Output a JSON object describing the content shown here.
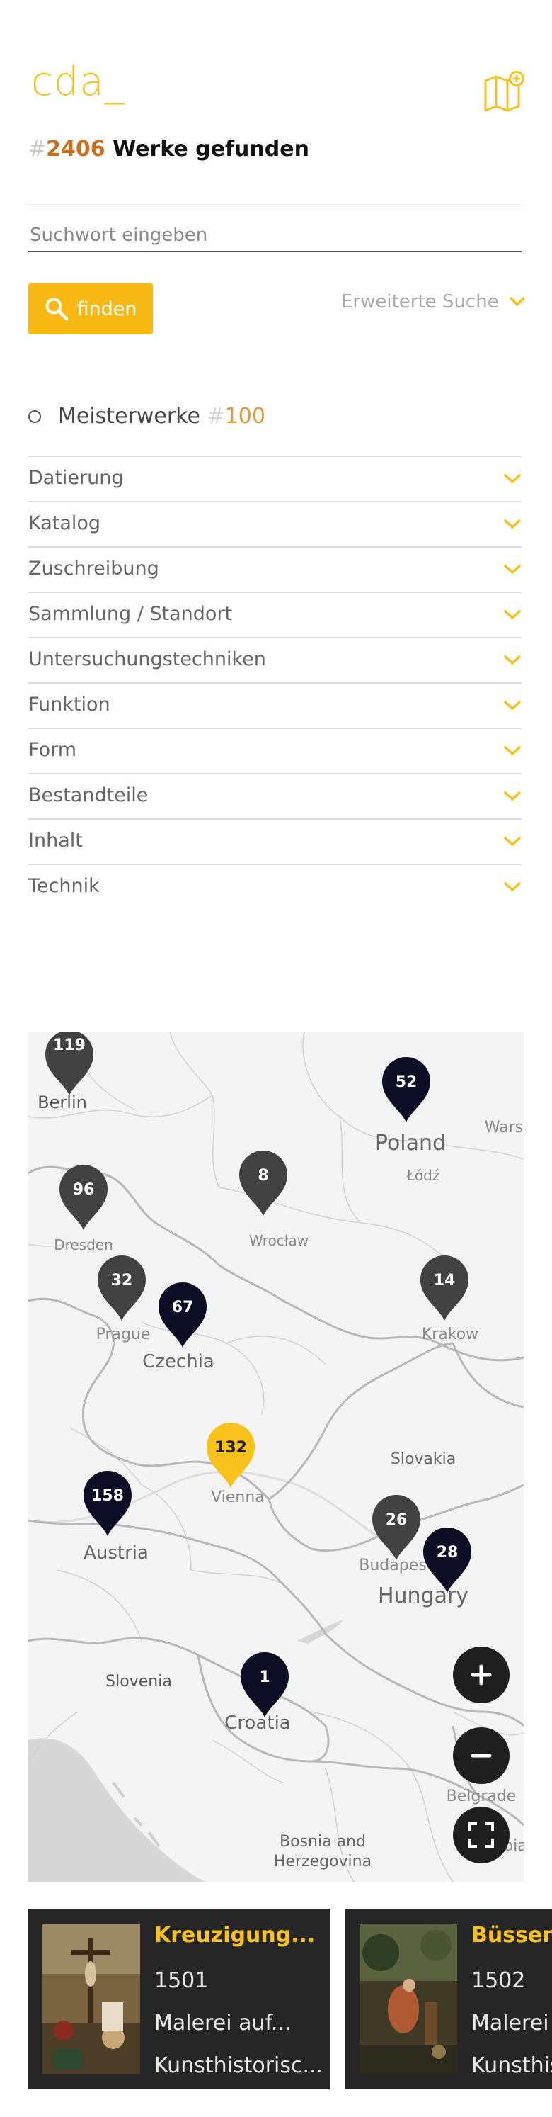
{
  "header": {
    "logo": "cda_",
    "map_icon": "map-plus-icon"
  },
  "results": {
    "hash": "#",
    "count": "2406",
    "label": " Werke gefunden"
  },
  "search": {
    "placeholder": "Suchwort eingeben",
    "value": "",
    "button_label": "finden",
    "button_icon": "search-icon",
    "advanced_label": "Erweiterte Suche"
  },
  "masterpieces": {
    "label": "Meisterwerke",
    "hash": "#",
    "count": "100"
  },
  "filters": [
    {
      "label": "Datierung"
    },
    {
      "label": "Katalog"
    },
    {
      "label": "Zuschreibung"
    },
    {
      "label": "Sammlung / Standort"
    },
    {
      "label": "Untersuchungstechniken"
    },
    {
      "label": "Funktion"
    },
    {
      "label": "Form"
    },
    {
      "label": "Bestandteile"
    },
    {
      "label": "Inhalt"
    },
    {
      "label": "Technik"
    }
  ],
  "map": {
    "places": {
      "berlin": "Berlin",
      "poland": "Poland",
      "warsaw": "Wars",
      "lodz": "Łódź",
      "dresden": "Dresden",
      "wroclaw": "Wrocław",
      "prague": "Prague",
      "krakow": "Krakow",
      "czechia": "Czechia",
      "slovakia": "Slovakia",
      "vienna": "Vienna",
      "austria": "Austria",
      "budapest": "Budapes",
      "hungary": "Hungary",
      "slovenia": "Slovenia",
      "croatia": "Croatia",
      "belgrade": "Belgrade",
      "bosnia_1": "Bosnia and",
      "bosnia_2": "Herzegovina",
      "edge_bia": "bia"
    },
    "markers": {
      "berlin": "119",
      "poland": "52",
      "dresden": "96",
      "wroclaw": "8",
      "prague": "32",
      "czechia": "67",
      "krakow": "14",
      "vienna": "132",
      "austria": "158",
      "budapest": "26",
      "hungary": "28",
      "croatia": "1"
    },
    "colors": {
      "grey": "#424242",
      "navy": "#0b0d25",
      "highlight": "#f8c21a"
    },
    "controls": {
      "zoom_in_icon": "plus-icon",
      "zoom_out_icon": "minus-icon",
      "fullscreen_icon": "fullscreen-icon"
    }
  },
  "cards": [
    {
      "title": "Kreuzigung...",
      "year": "1501",
      "material": "Malerei auf...",
      "museum": "Kunsthistorisc..."
    },
    {
      "title": "Büssend",
      "year": "1502",
      "material": "Malerei",
      "museum": "Kunsthis"
    }
  ],
  "theme": {
    "accent": "#f8c21a",
    "button": "#f8b914",
    "count_color": "#c8701e",
    "card_bg": "#262626"
  }
}
